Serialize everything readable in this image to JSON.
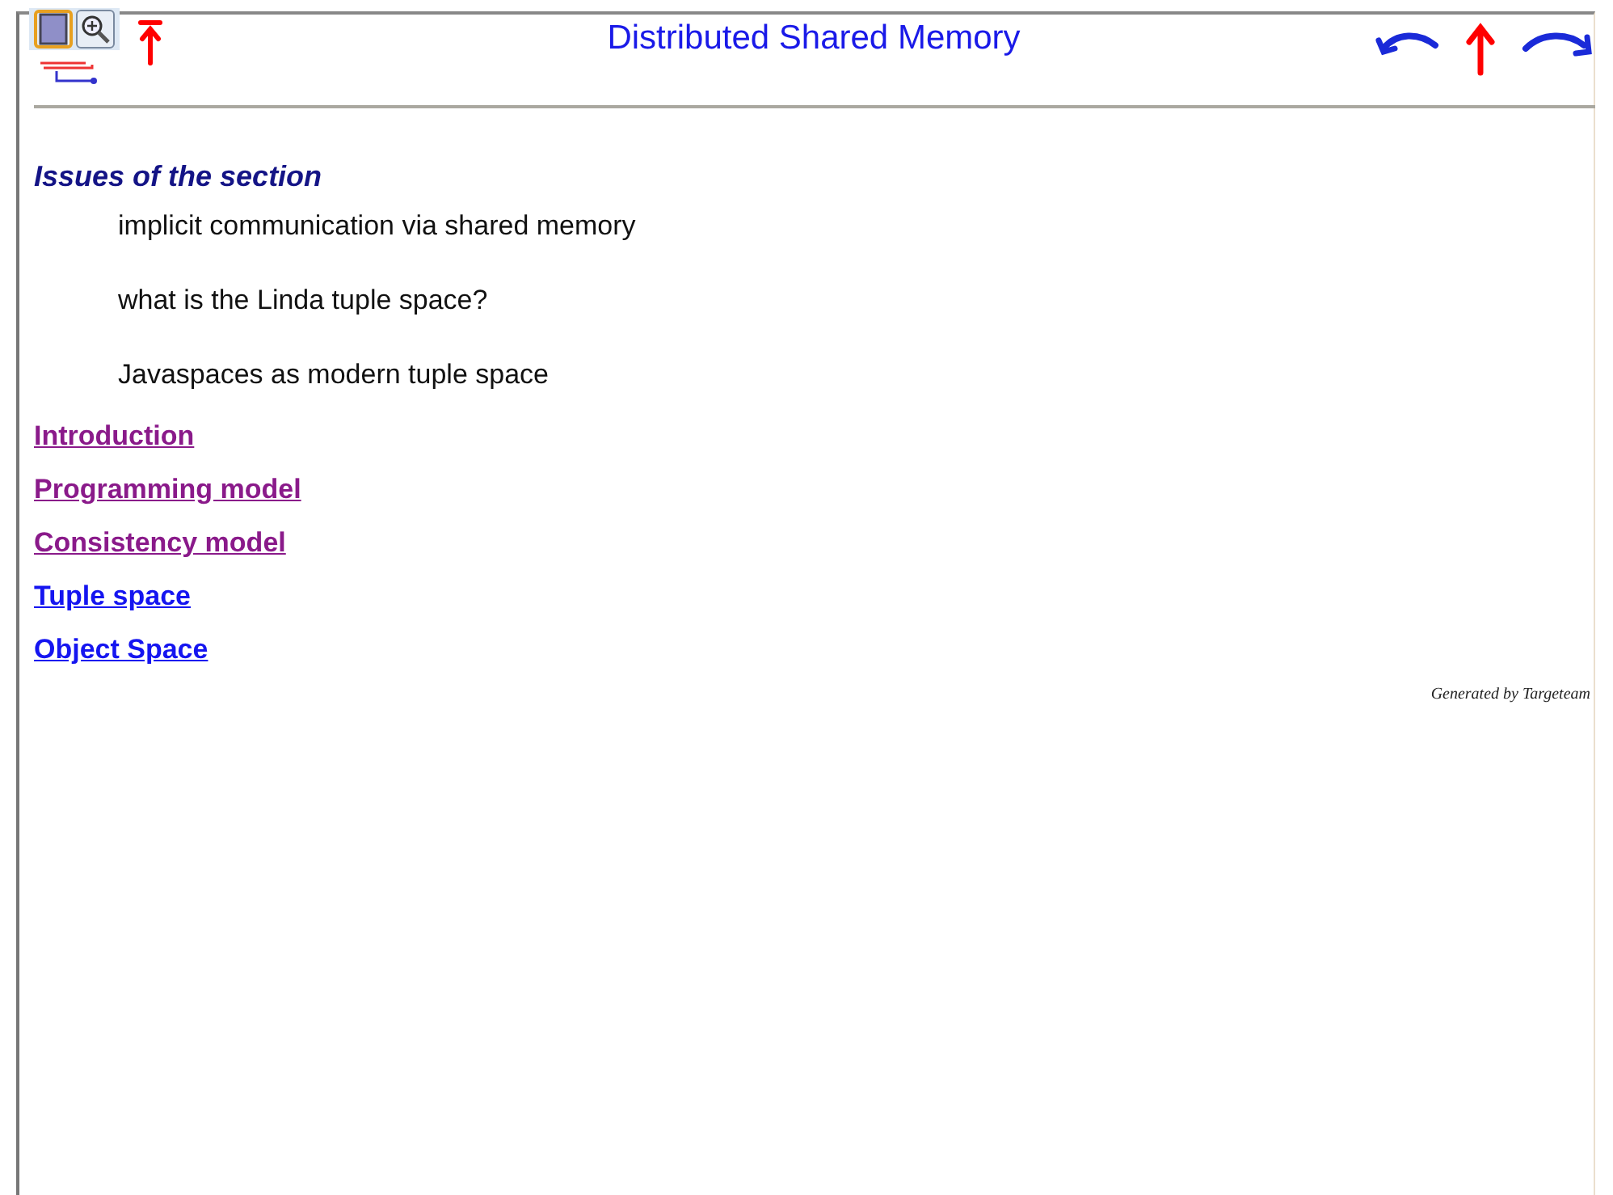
{
  "header": {
    "title": "Distributed Shared Memory"
  },
  "section": {
    "heading": "Issues of the section",
    "issues": [
      "implicit communication via shared memory",
      "what is the Linda tuple space?",
      "Javaspaces as modern tuple space"
    ]
  },
  "links": [
    {
      "label": "Introduction",
      "visited": true
    },
    {
      "label": "Programming model",
      "visited": true
    },
    {
      "label": "Consistency model",
      "visited": true
    },
    {
      "label": "Tuple space",
      "visited": false
    },
    {
      "label": "Object Space",
      "visited": false
    }
  ],
  "footer": "Generated by Targeteam"
}
